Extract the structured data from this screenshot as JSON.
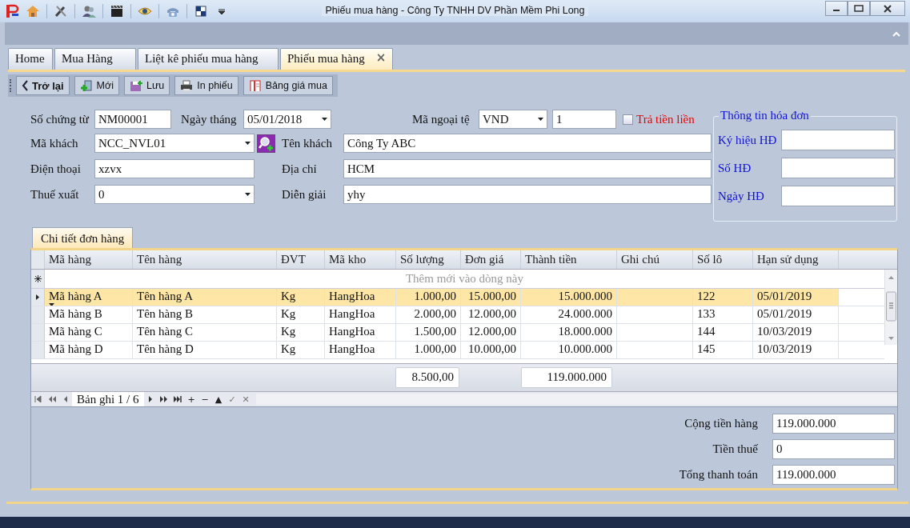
{
  "window": {
    "title": "Phiếu mua hàng - Công Ty TNHH DV Phần Mềm Phi Long"
  },
  "tabs": [
    {
      "label": "Home",
      "selected": false
    },
    {
      "label": "Mua Hàng",
      "selected": false
    },
    {
      "label": "Liệt kê phiếu mua hàng",
      "selected": false
    },
    {
      "label": "Phiếu mua hàng",
      "selected": true,
      "close": "×"
    }
  ],
  "toolbar": [
    {
      "label": "Trở lại",
      "kind": "back"
    },
    {
      "label": "Mới",
      "kind": "new"
    },
    {
      "label": "Lưu",
      "kind": "save"
    },
    {
      "label": "In phiếu",
      "kind": "print"
    },
    {
      "label": "Bảng giá mua",
      "kind": "book"
    }
  ],
  "header": {
    "so_chung_tu": {
      "label": "Số chứng từ",
      "value": "NM00001"
    },
    "ngay_thang": {
      "label": "Ngày tháng",
      "value": "05/01/2018"
    },
    "ma_ngoai_te": {
      "label": "Mã ngoại tệ",
      "value": "VND"
    },
    "ty_gia": {
      "value": "1"
    },
    "tra_tien_lien": {
      "label": "Trả tiền liền",
      "checked": false
    },
    "ma_khach": {
      "label": "Mã khách",
      "value": "NCC_NVL01"
    },
    "ten_khach": {
      "label": "Tên khách",
      "value": "Công Ty ABC"
    },
    "dien_thoai": {
      "label": "Điện thoại",
      "value": "xzvx"
    },
    "dia_chi": {
      "label": "Địa chỉ",
      "value": "HCM"
    },
    "thue_xuat": {
      "label": "Thuế xuất",
      "value": "0"
    },
    "dien_giai": {
      "label": "Diễn giải",
      "value": "yhy"
    }
  },
  "invoice": {
    "title": "Thông tin hóa đơn",
    "fields": [
      {
        "label": "Ký hiệu HĐ"
      },
      {
        "label": "Số HĐ"
      },
      {
        "label": "Ngày HĐ"
      }
    ]
  },
  "detail_tab": {
    "label": "Chi tiết đơn hàng",
    "selected": true
  },
  "grid": {
    "columns": [
      "Mã hàng",
      "Tên hàng",
      "ĐVT",
      "Mã kho",
      "Số lượng",
      "Đơn giá",
      "Thành tiền",
      "Ghi chú",
      "Số lô",
      "Hạn sử dụng"
    ],
    "new_row": "Thêm mới vào dòng này",
    "rows": [
      {
        "selected": true,
        "cells": [
          "Mã hàng A",
          "Tên hàng A",
          "Kg",
          "HangHoa",
          "1.000,00",
          "15.000,00",
          "15.000.000",
          "",
          "122",
          "05/01/2019"
        ]
      },
      {
        "selected": false,
        "cells": [
          "Mã hàng B",
          "Tên hàng B",
          "Kg",
          "HangHoa",
          "2.000,00",
          "12.000,00",
          "24.000.000",
          "",
          "133",
          "05/01/2019"
        ]
      },
      {
        "selected": false,
        "cells": [
          "Mã hàng C",
          "Tên hàng C",
          "Kg",
          "HangHoa",
          "1.500,00",
          "12.000,00",
          "18.000.000",
          "",
          "144",
          "10/03/2019"
        ]
      },
      {
        "selected": false,
        "cells": [
          "Mã hàng D",
          "Tên hàng D",
          "Kg",
          "HangHoa",
          "1.000,00",
          "10.000,00",
          "10.000.000",
          "",
          "145",
          "10/03/2019"
        ]
      }
    ],
    "sums": {
      "so_luong": "8.500,00",
      "thanh_tien": "119.000.000"
    },
    "navigator": {
      "record": "Bản ghi 1 / 6",
      "edit_buttons": [
        "+",
        "−",
        "▲",
        "✓",
        "✕"
      ]
    }
  },
  "totals": [
    {
      "label": "Cộng tiền hàng",
      "value": "119.000.000"
    },
    {
      "label": "Tiền thuế",
      "value": "0"
    },
    {
      "label": "Tổng thanh toán",
      "value": "119.000.000"
    }
  ]
}
